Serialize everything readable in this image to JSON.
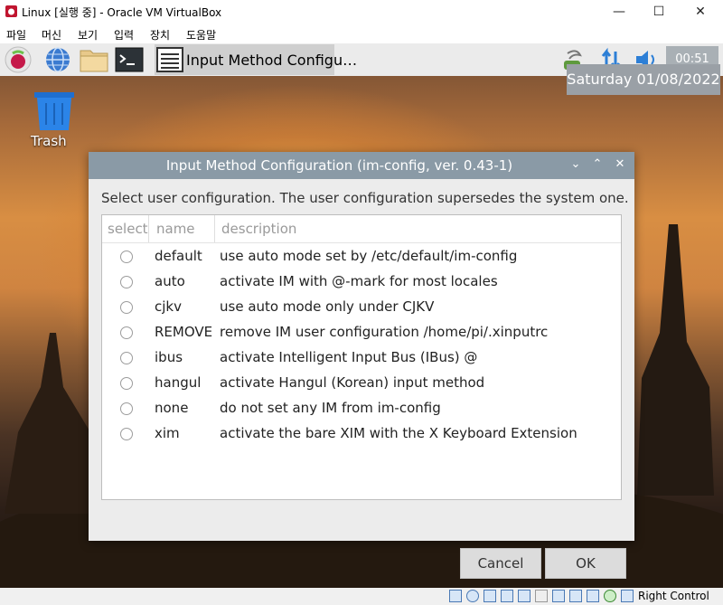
{
  "host": {
    "title": "Linux [실행 중] - Oracle VM VirtualBox",
    "menu": [
      "파일",
      "머신",
      "보기",
      "입력",
      "장치",
      "도움말"
    ],
    "controls": {
      "minimize": "—",
      "maximize": "☐",
      "close": "✕"
    },
    "statusbar": {
      "host_key": "Right Control"
    }
  },
  "guest": {
    "panel": {
      "task_label": "Input Method Configu…",
      "clock": "00:51",
      "date_tooltip": "Saturday 01/08/2022"
    },
    "desktop": {
      "trash_label": "Trash"
    }
  },
  "dialog": {
    "title": "Input Method Configuration (im-config, ver. 0.43-1)",
    "controls": {
      "minimize": "⌄",
      "maximize": "⌃",
      "close": "✕"
    },
    "prompt": "Select user configuration. The user configuration supersedes the system one.",
    "columns": {
      "select": "select",
      "name": "name",
      "description": "description"
    },
    "rows": [
      {
        "name": "default",
        "description": "use auto mode set by /etc/default/im-config"
      },
      {
        "name": "auto",
        "description": "activate IM with @-mark for most locales"
      },
      {
        "name": "cjkv",
        "description": "use auto mode only under CJKV"
      },
      {
        "name": "REMOVE",
        "description": "remove IM user configuration /home/pi/.xinputrc"
      },
      {
        "name": "ibus",
        "description": "activate Intelligent Input Bus (IBus) @"
      },
      {
        "name": "hangul",
        "description": "activate Hangul (Korean) input method"
      },
      {
        "name": "none",
        "description": "do not set any IM from im-config"
      },
      {
        "name": "xim",
        "description": "activate the bare XIM with the X Keyboard Extension"
      }
    ],
    "buttons": {
      "cancel": "Cancel",
      "ok": "OK"
    }
  }
}
